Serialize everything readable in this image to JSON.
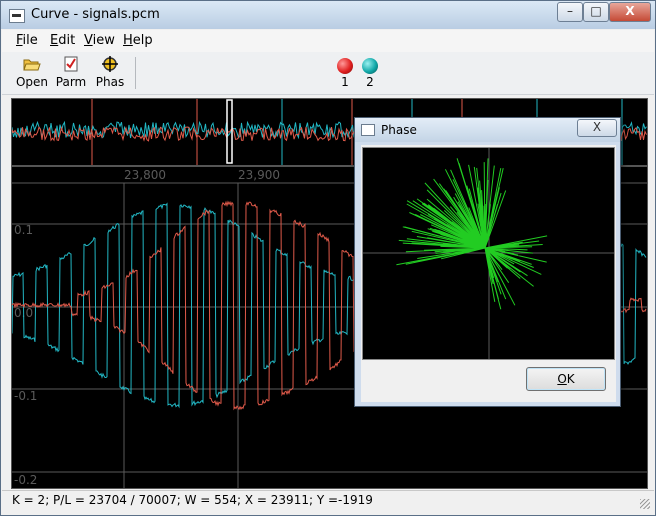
{
  "window": {
    "title": "Curve - signals.pcm"
  },
  "caption_buttons": {
    "minimize": "–",
    "maximize": "□",
    "close": "X"
  },
  "menu": [
    {
      "label": "File",
      "accel": "F",
      "rest": "ile"
    },
    {
      "label": "Edit",
      "accel": "E",
      "rest": "dit"
    },
    {
      "label": "View",
      "accel": "V",
      "rest": "iew"
    },
    {
      "label": "Help",
      "accel": "H",
      "rest": "elp"
    }
  ],
  "toolbar": {
    "open_label": "Open",
    "parm_label": "Parm",
    "phas_label": "Phas",
    "channels": [
      {
        "label": "1",
        "color": "#e02020"
      },
      {
        "label": "2",
        "color": "#10a8a8"
      }
    ]
  },
  "plot": {
    "x_ticks": [
      "23,800",
      "23,900"
    ],
    "y_ticks": [
      "0.1",
      "0.0",
      "-0.1",
      "-0.2"
    ],
    "colors": {
      "channel1": "#e05a4a",
      "channel2": "#22b7c4",
      "grid": "#5a5a5a",
      "axis_text": "#5a5a5a",
      "phase": "#22cc22"
    }
  },
  "dialog": {
    "title": "Phase",
    "close_label": "X",
    "ok_label": "OK",
    "ok_accel": "O",
    "ok_rest": "K"
  },
  "status": {
    "text": "K = 2; P/L = 23704 / 70007; W = 554; X = 23911; Y =-1919"
  }
}
